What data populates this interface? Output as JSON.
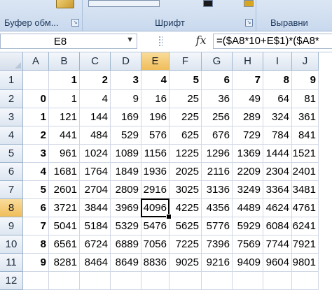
{
  "ribbon": {
    "groups": [
      {
        "label": "Буфер обм..."
      },
      {
        "label": "Шрифт"
      },
      {
        "label": "Выравни"
      }
    ],
    "launcher_glyph": "↘"
  },
  "formula_bar": {
    "name_box": "E8",
    "dropdown_glyph": "▼",
    "fx_label": "fx",
    "formula": "=($A8*10+E$1)*($A8*"
  },
  "sheet": {
    "columns": [
      "A",
      "B",
      "C",
      "D",
      "E",
      "F",
      "G",
      "H",
      "I",
      "J"
    ],
    "active_column": "E",
    "active_row": "8",
    "rows": [
      {
        "num": "1",
        "cells": [
          "",
          "1",
          "2",
          "3",
          "4",
          "5",
          "6",
          "7",
          "8",
          "9"
        ]
      },
      {
        "num": "2",
        "cells": [
          "0",
          "1",
          "4",
          "9",
          "16",
          "25",
          "36",
          "49",
          "64",
          "81"
        ]
      },
      {
        "num": "3",
        "cells": [
          "1",
          "121",
          "144",
          "169",
          "196",
          "225",
          "256",
          "289",
          "324",
          "361"
        ]
      },
      {
        "num": "4",
        "cells": [
          "2",
          "441",
          "484",
          "529",
          "576",
          "625",
          "676",
          "729",
          "784",
          "841"
        ]
      },
      {
        "num": "5",
        "cells": [
          "3",
          "961",
          "1024",
          "1089",
          "1156",
          "1225",
          "1296",
          "1369",
          "1444",
          "1521"
        ]
      },
      {
        "num": "6",
        "cells": [
          "4",
          "1681",
          "1764",
          "1849",
          "1936",
          "2025",
          "2116",
          "2209",
          "2304",
          "2401"
        ]
      },
      {
        "num": "7",
        "cells": [
          "5",
          "2601",
          "2704",
          "2809",
          "2916",
          "3025",
          "3136",
          "3249",
          "3364",
          "3481"
        ]
      },
      {
        "num": "8",
        "cells": [
          "6",
          "3721",
          "3844",
          "3969",
          "4096",
          "4225",
          "4356",
          "4489",
          "4624",
          "4761"
        ]
      },
      {
        "num": "9",
        "cells": [
          "7",
          "5041",
          "5184",
          "5329",
          "5476",
          "5625",
          "5776",
          "5929",
          "6084",
          "6241"
        ]
      },
      {
        "num": "10",
        "cells": [
          "8",
          "6561",
          "6724",
          "6889",
          "7056",
          "7225",
          "7396",
          "7569",
          "7744",
          "7921"
        ]
      },
      {
        "num": "11",
        "cells": [
          "9",
          "8281",
          "8464",
          "8649",
          "8836",
          "9025",
          "9216",
          "9409",
          "9604",
          "9801"
        ]
      },
      {
        "num": "12",
        "cells": [
          "",
          "",
          "",
          "",
          "",
          "",
          "",
          "",
          "",
          ""
        ]
      }
    ]
  }
}
